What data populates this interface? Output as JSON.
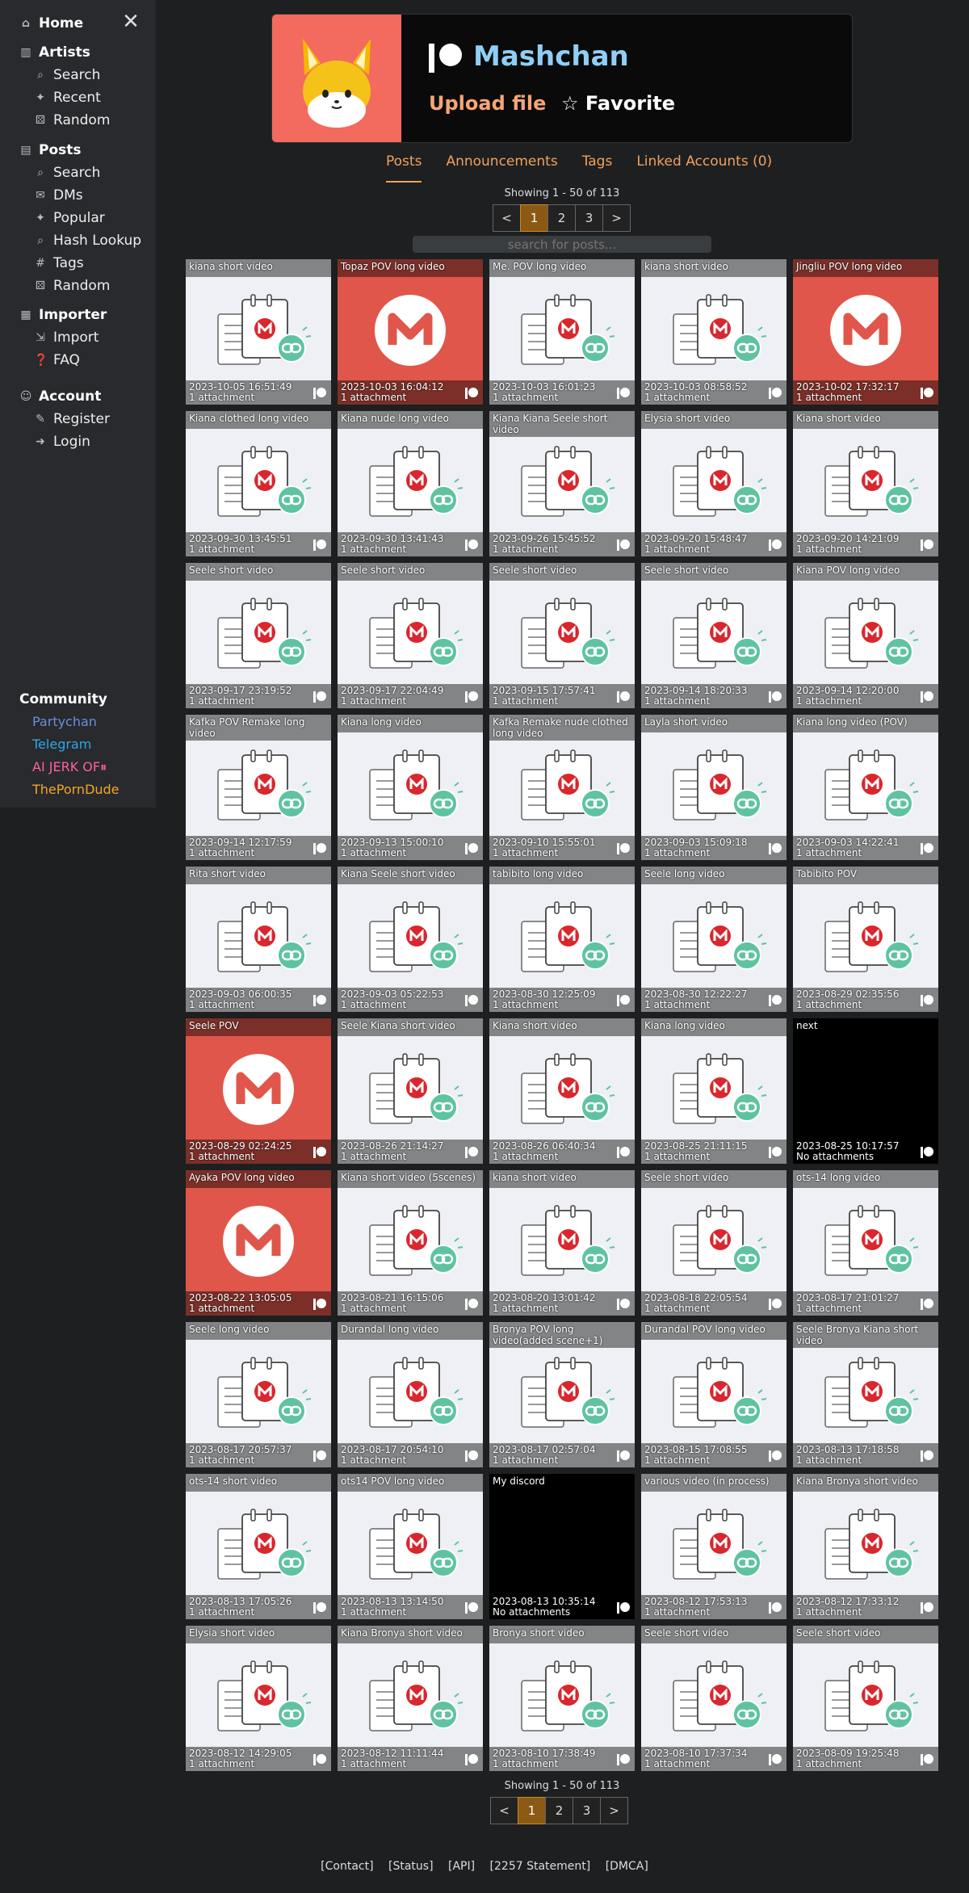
{
  "sidebar": {
    "home": "Home",
    "artists": {
      "label": "Artists",
      "items": [
        "Search",
        "Recent",
        "Random"
      ]
    },
    "posts": {
      "label": "Posts",
      "items": [
        "Search",
        "DMs",
        "Popular",
        "Hash Lookup",
        "Tags",
        "Random"
      ]
    },
    "importer": {
      "label": "Importer",
      "items": [
        "Import",
        "FAQ"
      ]
    },
    "account": {
      "label": "Account",
      "items": [
        "Register",
        "Login"
      ]
    },
    "community": {
      "label": "Community",
      "links": [
        {
          "label": "Partychan",
          "color": "#6b8fd6"
        },
        {
          "label": "Telegram",
          "color": "#2ea6e6"
        },
        {
          "label": "AI JERK OF⏸",
          "color": "#ff5fa2"
        },
        {
          "label": "ThePornDude",
          "color": "#f5a623"
        }
      ]
    }
  },
  "header": {
    "name": "Mashchan",
    "upload": "Upload file",
    "favorite": "☆ Favorite"
  },
  "tabs": [
    "Posts",
    "Announcements",
    "Tags",
    "Linked Accounts (0)"
  ],
  "pagination": {
    "showing": "Showing 1 - 50 of 113",
    "pages": [
      "<",
      "1",
      "2",
      "3",
      ">"
    ],
    "current": "1"
  },
  "search": {
    "placeholder": "search for posts..."
  },
  "posts": [
    {
      "title": "kiana short video",
      "date": "2023-10-05 16:51:49",
      "attachments": "1 attachment",
      "thumb": "doc"
    },
    {
      "title": "Topaz POV long video",
      "date": "2023-10-03 16:04:12",
      "attachments": "1 attachment",
      "thumb": "mega"
    },
    {
      "title": "Me. POV long video",
      "date": "2023-10-03 16:01:23",
      "attachments": "1 attachment",
      "thumb": "doc"
    },
    {
      "title": "kiana short video",
      "date": "2023-10-03 08:58:52",
      "attachments": "1 attachment",
      "thumb": "doc"
    },
    {
      "title": "Jingliu POV long video",
      "date": "2023-10-02 17:32:17",
      "attachments": "1 attachment",
      "thumb": "mega"
    },
    {
      "title": "Kiana clothed long video",
      "date": "2023-09-30 13:45:51",
      "attachments": "1 attachment",
      "thumb": "doc"
    },
    {
      "title": "Kiana nude long video",
      "date": "2023-09-30 13:41:43",
      "attachments": "1 attachment",
      "thumb": "doc"
    },
    {
      "title": "Kiana Kiana Seele short video",
      "date": "2023-09-26 15:45:52",
      "attachments": "1 attachment",
      "thumb": "doc"
    },
    {
      "title": "Elysia short video",
      "date": "2023-09-20 15:48:47",
      "attachments": "1 attachment",
      "thumb": "doc"
    },
    {
      "title": "Kiana short video",
      "date": "2023-09-20 14:21:09",
      "attachments": "1 attachment",
      "thumb": "doc"
    },
    {
      "title": "Seele short video",
      "date": "2023-09-17 23:19:52",
      "attachments": "1 attachment",
      "thumb": "doc"
    },
    {
      "title": "Seele short video",
      "date": "2023-09-17 22:04:49",
      "attachments": "1 attachment",
      "thumb": "doc"
    },
    {
      "title": "Seele short video",
      "date": "2023-09-15 17:57:41",
      "attachments": "1 attachment",
      "thumb": "doc"
    },
    {
      "title": "Seele short video",
      "date": "2023-09-14 18:20:33",
      "attachments": "1 attachment",
      "thumb": "doc"
    },
    {
      "title": "Kiana POV long video",
      "date": "2023-09-14 12:20:00",
      "attachments": "1 attachment",
      "thumb": "doc"
    },
    {
      "title": "Kafka POV Remake long video",
      "date": "2023-09-14 12:17:59",
      "attachments": "1 attachment",
      "thumb": "doc"
    },
    {
      "title": "Kiana long video",
      "date": "2023-09-13 15:00:10",
      "attachments": "1 attachment",
      "thumb": "doc"
    },
    {
      "title": "Kafka Remake nude clothed long video",
      "date": "2023-09-10 15:55:01",
      "attachments": "1 attachment",
      "thumb": "doc"
    },
    {
      "title": "Layla short video",
      "date": "2023-09-03 15:09:18",
      "attachments": "1 attachment",
      "thumb": "doc"
    },
    {
      "title": "Kiana long video (POV)",
      "date": "2023-09-03 14:22:41",
      "attachments": "1 attachment",
      "thumb": "doc"
    },
    {
      "title": "Rita short video",
      "date": "2023-09-03 06:00:35",
      "attachments": "1 attachment",
      "thumb": "doc"
    },
    {
      "title": "Kiana Seele short video",
      "date": "2023-09-03 05:22:53",
      "attachments": "1 attachment",
      "thumb": "doc"
    },
    {
      "title": "tabibito long video",
      "date": "2023-08-30 12:25:09",
      "attachments": "1 attachment",
      "thumb": "doc"
    },
    {
      "title": "Seele long video",
      "date": "2023-08-30 12:22:27",
      "attachments": "1 attachment",
      "thumb": "doc"
    },
    {
      "title": "Tabibito POV",
      "date": "2023-08-29 02:35:56",
      "attachments": "1 attachment",
      "thumb": "doc"
    },
    {
      "title": "Seele POV",
      "date": "2023-08-29 02:24:25",
      "attachments": "1 attachment",
      "thumb": "mega"
    },
    {
      "title": "Seele Kiana short video",
      "date": "2023-08-26 21:14:27",
      "attachments": "1 attachment",
      "thumb": "doc"
    },
    {
      "title": "Kiana short video",
      "date": "2023-08-26 06:40:34",
      "attachments": "1 attachment",
      "thumb": "doc"
    },
    {
      "title": "Kiana long video",
      "date": "2023-08-25 21:11:15",
      "attachments": "1 attachment",
      "thumb": "doc"
    },
    {
      "title": "next",
      "date": "2023-08-25 10:17:57",
      "attachments": "No attachments",
      "thumb": "none"
    },
    {
      "title": "Ayaka POV long video",
      "date": "2023-08-22 13:05:05",
      "attachments": "1 attachment",
      "thumb": "mega"
    },
    {
      "title": "Kiana short video (5scenes)",
      "date": "2023-08-21 16:15:06",
      "attachments": "1 attachment",
      "thumb": "doc"
    },
    {
      "title": "kiana short video",
      "date": "2023-08-20 13:01:42",
      "attachments": "1 attachment",
      "thumb": "doc"
    },
    {
      "title": "Seele short video",
      "date": "2023-08-18 22:05:54",
      "attachments": "1 attachment",
      "thumb": "doc"
    },
    {
      "title": "ots-14 long video",
      "date": "2023-08-17 21:01:27",
      "attachments": "1 attachment",
      "thumb": "doc"
    },
    {
      "title": "Seele long video",
      "date": "2023-08-17 20:57:37",
      "attachments": "1 attachment",
      "thumb": "doc"
    },
    {
      "title": "Durandal long video",
      "date": "2023-08-17 20:54:10",
      "attachments": "1 attachment",
      "thumb": "doc"
    },
    {
      "title": "Bronya POV long video(added scene+1)",
      "date": "2023-08-17 02:57:04",
      "attachments": "1 attachment",
      "thumb": "doc"
    },
    {
      "title": "Durandal POV long video",
      "date": "2023-08-15 17:08:55",
      "attachments": "1 attachment",
      "thumb": "doc"
    },
    {
      "title": "Seele Bronya Kiana short video",
      "date": "2023-08-13 17:18:58",
      "attachments": "1 attachment",
      "thumb": "doc"
    },
    {
      "title": "ots-14 short video",
      "date": "2023-08-13 17:05:26",
      "attachments": "1 attachment",
      "thumb": "doc"
    },
    {
      "title": "ots14 POV long video",
      "date": "2023-08-13 13:14:50",
      "attachments": "1 attachment",
      "thumb": "doc"
    },
    {
      "title": "My discord",
      "date": "2023-08-13 10:35:14",
      "attachments": "No attachments",
      "thumb": "none"
    },
    {
      "title": "various video (in process)",
      "date": "2023-08-12 17:53:13",
      "attachments": "1 attachment",
      "thumb": "doc"
    },
    {
      "title": "Kiana Bronya short video",
      "date": "2023-08-12 17:33:12",
      "attachments": "1 attachment",
      "thumb": "doc"
    },
    {
      "title": "Elysia short video",
      "date": "2023-08-12 14:29:05",
      "attachments": "1 attachment",
      "thumb": "doc"
    },
    {
      "title": "Kiana Bronya short video",
      "date": "2023-08-12 11:11:44",
      "attachments": "1 attachment",
      "thumb": "doc"
    },
    {
      "title": "Bronya short video",
      "date": "2023-08-10 17:38:49",
      "attachments": "1 attachment",
      "thumb": "doc"
    },
    {
      "title": "Seele short video",
      "date": "2023-08-10 17:37:34",
      "attachments": "1 attachment",
      "thumb": "doc"
    },
    {
      "title": "Seele short video",
      "date": "2023-08-09 19:25:48",
      "attachments": "1 attachment",
      "thumb": "doc"
    }
  ],
  "footer": [
    "[Contact]",
    "[Status]",
    "[API]",
    "[2257 Statement]",
    "[DMCA]"
  ],
  "colors": {
    "accent": "#f0a15f",
    "name": "#8fcff5",
    "avatar_bg": "#f26b5e",
    "mega_red": "#d9272e"
  }
}
